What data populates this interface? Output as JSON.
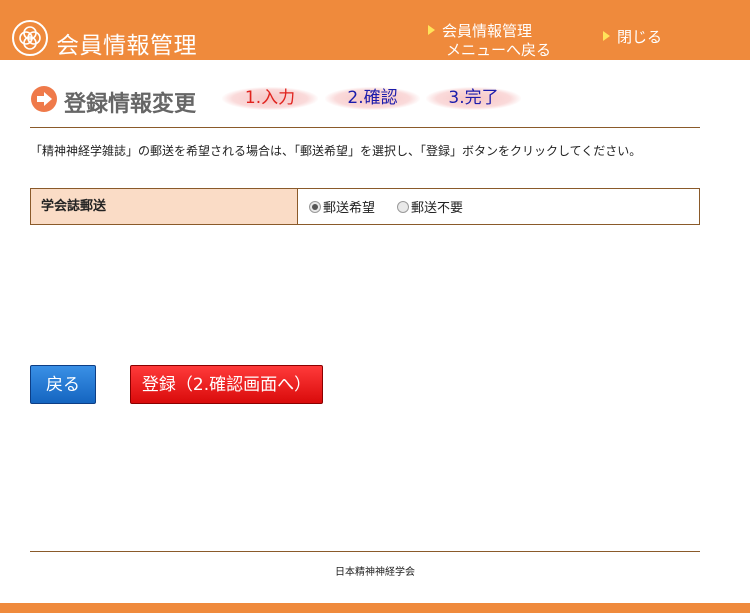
{
  "header": {
    "logo_icon": "society-emblem-icon",
    "title": "会員情報管理",
    "menu_link_line1": "会員情報管理",
    "menu_link_line2": "メニューへ戻る",
    "close_link": "閉じる"
  },
  "page": {
    "heading": "登録情報変更",
    "heading_icon": "arrow-right-circle-icon",
    "steps": [
      "1.入力",
      "2.確認",
      "3.完了"
    ],
    "active_step": 0
  },
  "instruction": "「精神神経学雑誌」の郵送を希望される場合は、「郵送希望」を選択し、「登録」ボタンをクリックしてください。",
  "form": {
    "label": "学会誌郵送",
    "options": [
      {
        "label": "郵送希望",
        "checked": true
      },
      {
        "label": "郵送不要",
        "checked": false
      }
    ]
  },
  "buttons": {
    "back": "戻る",
    "submit": "登録（2.確認画面へ）"
  },
  "footer": {
    "organization": "日本精神神経学会"
  },
  "colors": {
    "brand_orange": "#ef8a3c",
    "step_active": "#e0231e",
    "step_inactive": "#1c1cab",
    "label_bg": "#fadcc6",
    "back_button": "#1565c0",
    "submit_button": "#d90b0b"
  }
}
